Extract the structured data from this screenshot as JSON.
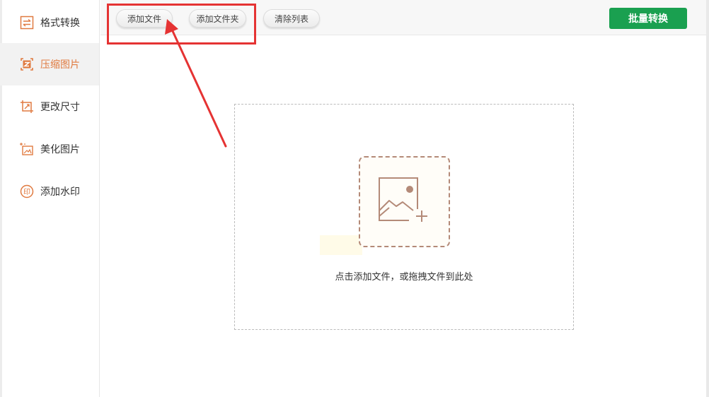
{
  "sidebar": {
    "items": [
      {
        "label": "格式转换",
        "icon": "format-convert-icon",
        "active": false
      },
      {
        "label": "压缩图片",
        "icon": "compress-image-icon",
        "active": true
      },
      {
        "label": "更改尺寸",
        "icon": "resize-icon",
        "active": false
      },
      {
        "label": "美化图片",
        "icon": "beautify-image-icon",
        "active": false
      },
      {
        "label": "添加水印",
        "icon": "watermark-icon",
        "active": false
      }
    ]
  },
  "toolbar": {
    "add_file_label": "添加文件",
    "add_folder_label": "添加文件夹",
    "clear_list_label": "清除列表",
    "batch_convert_label": "批量转换"
  },
  "drop_zone": {
    "hint": "点击添加文件，或拖拽文件到此处",
    "icon": "add-image-icon"
  },
  "colors": {
    "accent": "#e07a40",
    "primary_button": "#1aa050",
    "annotation": "#e53333",
    "upload_icon": "#b48a78"
  }
}
